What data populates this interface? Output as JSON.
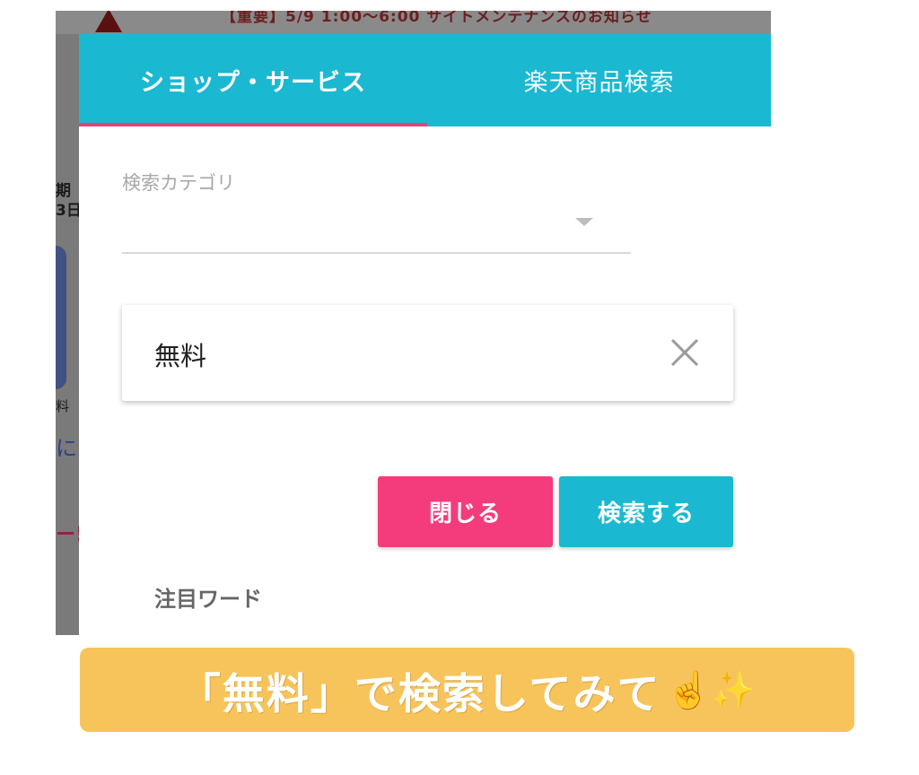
{
  "background": {
    "notice_text": "【重要】5/9 1:00〜6:00 サイトメンテナンスのお知らせ",
    "fragments": [
      "期",
      "3日",
      "料",
      "に",
      "ー!"
    ]
  },
  "tabs": [
    {
      "label": "ショップ・サービス",
      "active": true
    },
    {
      "label": "楽天商品検索",
      "active": false
    }
  ],
  "category": {
    "label": "検索カテゴリ",
    "value": ""
  },
  "search": {
    "value": "無料",
    "placeholder": ""
  },
  "buttons": {
    "close": "閉じる",
    "search": "検索する"
  },
  "trending": {
    "label": "注目ワード"
  },
  "caption": {
    "text": "「無料」で検索してみて",
    "emoji": "☝️✨"
  },
  "colors": {
    "accent": "#1bb8d2",
    "close_button": "#f43c7c",
    "tab_indicator": "#e8407a",
    "caption_bg": "#f7c45c"
  }
}
